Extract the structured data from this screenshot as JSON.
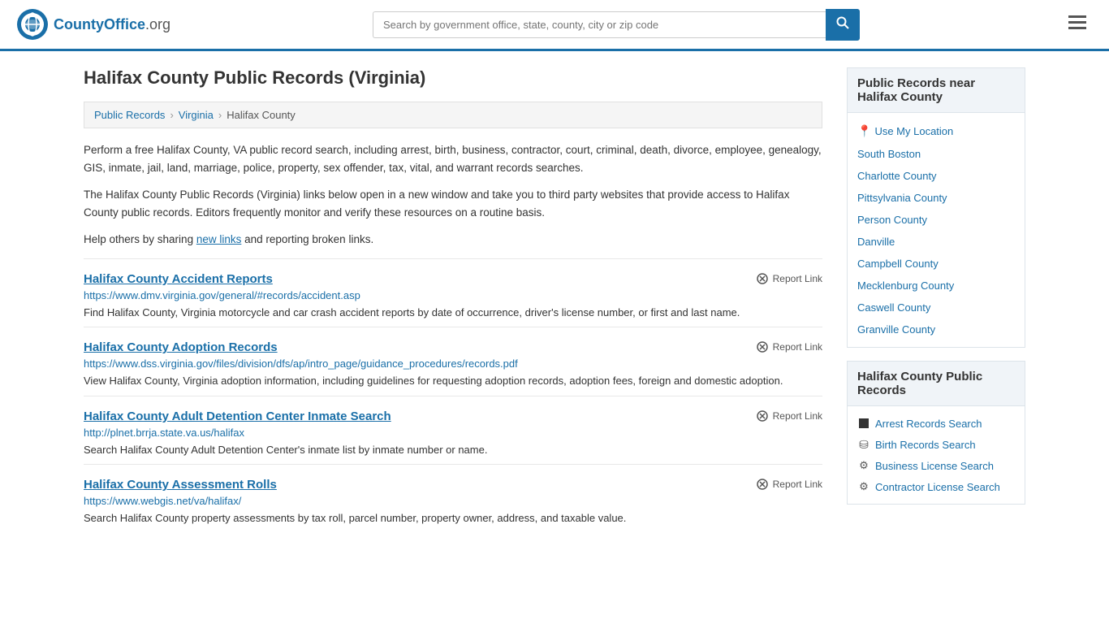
{
  "header": {
    "logo_text": "CountyOffice",
    "logo_suffix": ".org",
    "search_placeholder": "Search by government office, state, county, city or zip code",
    "search_icon": "🔍",
    "menu_icon": "≡"
  },
  "page": {
    "title": "Halifax County Public Records (Virginia)",
    "breadcrumb": [
      "Public Records",
      "Virginia",
      "Halifax County"
    ],
    "description1": "Perform a free Halifax County, VA public record search, including arrest, birth, business, contractor, court, criminal, death, divorce, employee, genealogy, GIS, inmate, jail, land, marriage, police, property, sex offender, tax, vital, and warrant records searches.",
    "description2": "The Halifax County Public Records (Virginia) links below open in a new window and take you to third party websites that provide access to Halifax County public records. Editors frequently monitor and verify these resources on a routine basis.",
    "description3_pre": "Help others by sharing ",
    "description3_link": "new links",
    "description3_post": " and reporting broken links."
  },
  "records": [
    {
      "title": "Halifax County Accident Reports",
      "url": "https://www.dmv.virginia.gov/general/#records/accident.asp",
      "description": "Find Halifax County, Virginia motorcycle and car crash accident reports by date of occurrence, driver's license number, or first and last name."
    },
    {
      "title": "Halifax County Adoption Records",
      "url": "https://www.dss.virginia.gov/files/division/dfs/ap/intro_page/guidance_procedures/records.pdf",
      "description": "View Halifax County, Virginia adoption information, including guidelines for requesting adoption records, adoption fees, foreign and domestic adoption."
    },
    {
      "title": "Halifax County Adult Detention Center Inmate Search",
      "url": "http://plnet.brrja.state.va.us/halifax",
      "description": "Search Halifax County Adult Detention Center's inmate list by inmate number or name."
    },
    {
      "title": "Halifax County Assessment Rolls",
      "url": "https://www.webgis.net/va/halifax/",
      "description": "Search Halifax County property assessments by tax roll, parcel number, property owner, address, and taxable value."
    }
  ],
  "report_link_label": "Report Link",
  "sidebar": {
    "nearby_title": "Public Records near Halifax County",
    "use_my_location": "Use My Location",
    "nearby_places": [
      "South Boston",
      "Charlotte County",
      "Pittsylvania County",
      "Person County",
      "Danville",
      "Campbell County",
      "Mecklenburg County",
      "Caswell County",
      "Granville County"
    ],
    "public_records_title": "Halifax County Public Records",
    "public_records_items": [
      {
        "label": "Arrest Records Search",
        "icon": "square"
      },
      {
        "label": "Birth Records Search",
        "icon": "person"
      },
      {
        "label": "Business License Search",
        "icon": "gear"
      },
      {
        "label": "Contractor License Search",
        "icon": "gear"
      }
    ]
  }
}
